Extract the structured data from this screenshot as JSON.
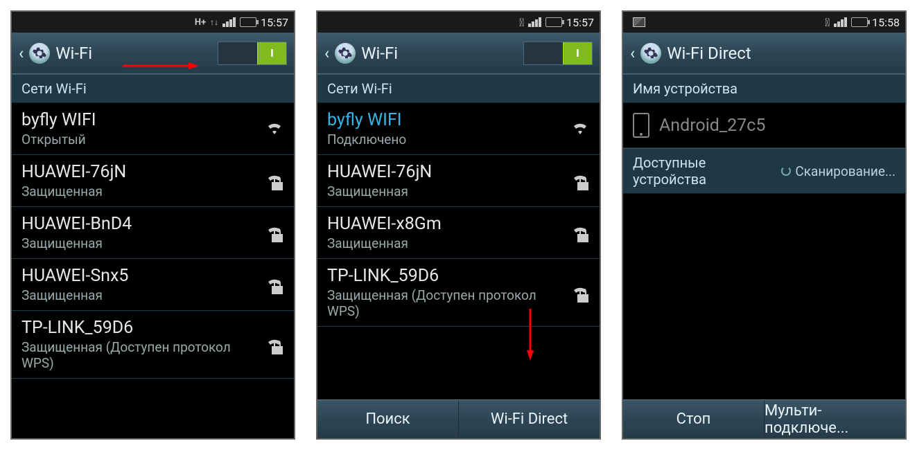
{
  "screen1": {
    "time": "15:57",
    "data_indicator": "H+",
    "title": "Wi-Fi",
    "section_header": "Сети Wi-Fi",
    "networks": [
      {
        "name": "byfly WIFI",
        "sub": "Открытый",
        "secured": false,
        "connected": false
      },
      {
        "name": "HUAWEI-76jN",
        "sub": "Защищенная",
        "secured": true,
        "connected": false
      },
      {
        "name": "HUAWEI-BnD4",
        "sub": "Защищенная",
        "secured": true,
        "connected": false
      },
      {
        "name": "HUAWEI-Snx5",
        "sub": "Защищенная",
        "secured": true,
        "connected": false
      },
      {
        "name": "TP-LINK_59D6",
        "sub": "Защищенная (Доступен протокол WPS)",
        "secured": true,
        "connected": false
      }
    ]
  },
  "screen2": {
    "time": "15:57",
    "title": "Wi-Fi",
    "section_header": "Сети Wi-Fi",
    "networks": [
      {
        "name": "byfly WIFI",
        "sub": "Подключено",
        "secured": false,
        "connected": true
      },
      {
        "name": "HUAWEI-76jN",
        "sub": "Защищенная",
        "secured": true,
        "connected": false
      },
      {
        "name": "HUAWEI-x8Gm",
        "sub": "Защищенная",
        "secured": true,
        "connected": false
      },
      {
        "name": "TP-LINK_59D6",
        "sub": "Защищенная (Доступен протокол WPS)",
        "secured": true,
        "connected": false
      }
    ],
    "buttons": {
      "scan": "Поиск",
      "direct": "Wi-Fi Direct"
    }
  },
  "screen3": {
    "time": "15:58",
    "title": "Wi-Fi Direct",
    "device_name_header": "Имя устройства",
    "device_name": "Android_27c5",
    "available_header": "Доступные устройства",
    "scanning_label": "Сканирование...",
    "buttons": {
      "stop": "Стоп",
      "multi": "Мульти-подключе..."
    }
  }
}
